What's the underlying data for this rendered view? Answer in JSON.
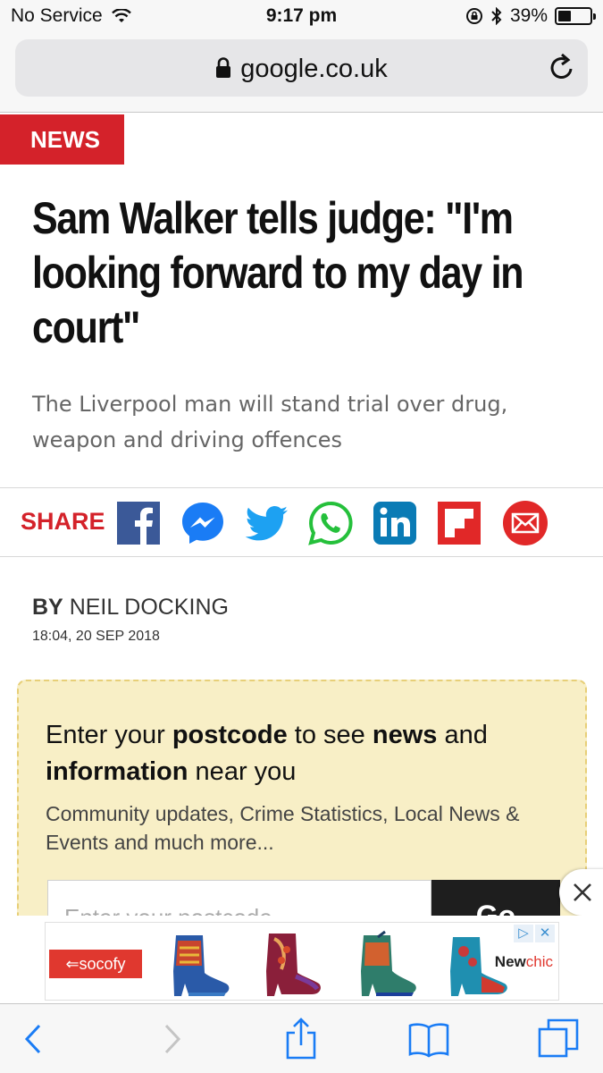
{
  "status_bar": {
    "carrier": "No Service",
    "time": "9:17 pm",
    "battery": "39%",
    "battery_level": 0.39
  },
  "url_bar": {
    "domain": "google.co.uk"
  },
  "article": {
    "section": "NEWS",
    "headline": "Sam Walker tells judge: \"I'm looking forward to my day in court\"",
    "subheadline": "The Liverpool man will stand trial over drug, weapon and driving offences",
    "share_label": "SHARE",
    "byline_prefix": "BY",
    "author": "NEIL DOCKING",
    "timestamp": "18:04, 20 SEP 2018"
  },
  "share_icons": [
    "facebook-icon",
    "messenger-icon",
    "twitter-icon",
    "whatsapp-icon",
    "linkedin-icon",
    "flipboard-icon",
    "email-icon"
  ],
  "postcode_widget": {
    "title_parts": [
      "Enter your ",
      "postcode",
      " to see ",
      "news",
      " and ",
      "information",
      " near you"
    ],
    "subtitle": "Community updates, Crime Statistics, Local News & Events and much more...",
    "placeholder": "Enter your postcode",
    "button": "Go"
  },
  "ad": {
    "brand_left": "socofy",
    "brand_right_a": "New",
    "brand_right_b": "chic"
  },
  "colors": {
    "accent_red": "#d4222a",
    "postcode_bg": "#f8efc6",
    "ios_blue": "#1a7cf5"
  }
}
